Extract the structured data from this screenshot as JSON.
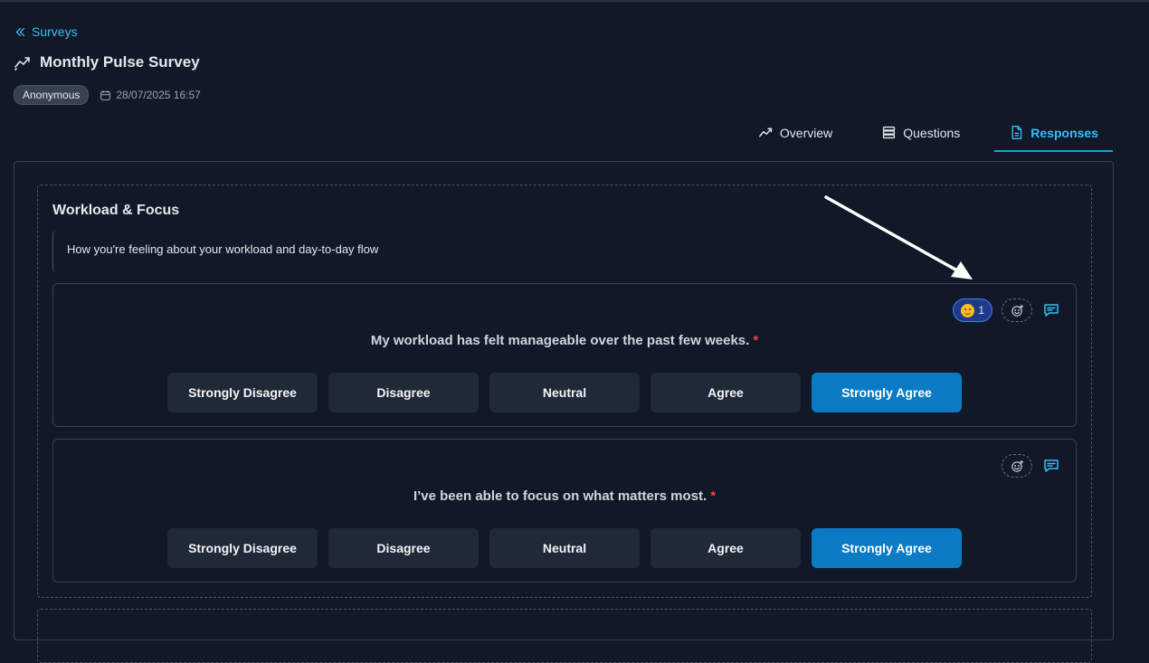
{
  "nav": {
    "back_label": "Surveys"
  },
  "survey": {
    "title": "Monthly Pulse Survey",
    "badge": "Anonymous",
    "date": "28/07/2025 16:57"
  },
  "tabs": [
    {
      "label": "Overview",
      "icon": "trend-icon",
      "active": false
    },
    {
      "label": "Questions",
      "icon": "list-icon",
      "active": false
    },
    {
      "label": "Responses",
      "icon": "document-icon",
      "active": true
    }
  ],
  "section": {
    "title": "Workload & Focus",
    "description": "How you're feeling about your workload and day-to-day flow"
  },
  "questions": [
    {
      "text": "My workload has felt manageable over the past few weeks.",
      "required_mark": "*",
      "reaction": {
        "emoji": "smiling-face",
        "count": "1"
      },
      "options": [
        "Strongly Disagree",
        "Disagree",
        "Neutral",
        "Agree",
        "Strongly Agree"
      ],
      "selected": "Strongly Agree"
    },
    {
      "text": "I’ve been able to focus on what matters most.",
      "required_mark": "*",
      "options": [
        "Strongly Disagree",
        "Disagree",
        "Neutral",
        "Agree",
        "Strongly Agree"
      ],
      "selected": "Strongly Agree"
    }
  ],
  "colors": {
    "accent": "#0ea5e9",
    "selected_option": "#0b7bc3",
    "required": "#ef4444",
    "background": "#111827"
  }
}
